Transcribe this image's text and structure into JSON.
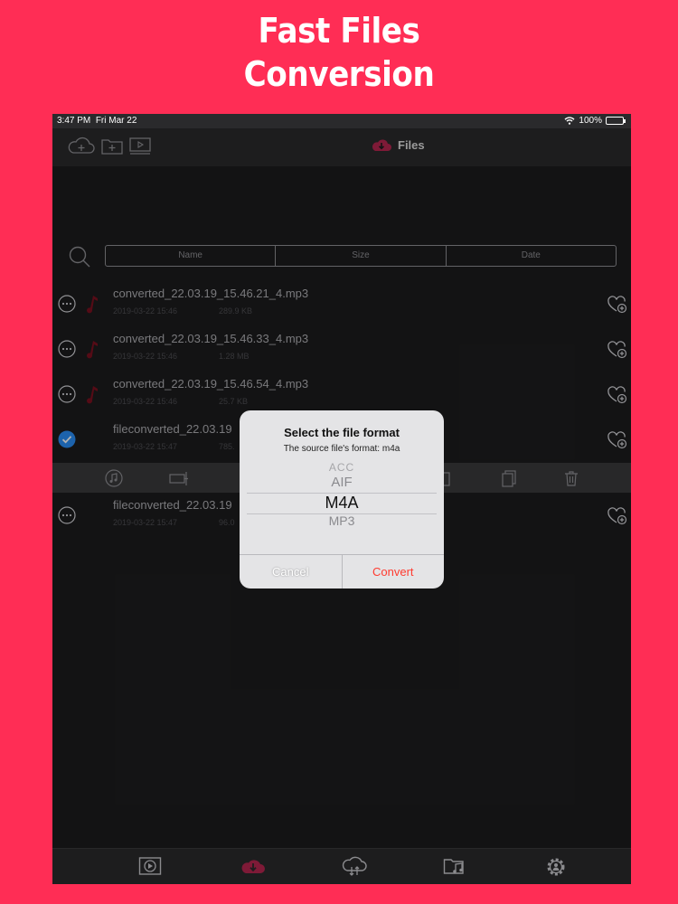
{
  "hero": {
    "line1": "Fast Files",
    "line2": "Conversion"
  },
  "status_bar": {
    "time": "3:47 PM",
    "date": "Fri Mar 22",
    "battery": "100%"
  },
  "nav": {
    "title": "Files",
    "icons": [
      "cloud-add-icon",
      "folder-add-icon",
      "media-icon",
      "cloud-download-icon"
    ]
  },
  "table_header": {
    "columns": [
      "Name",
      "Size",
      "Date"
    ]
  },
  "files": [
    {
      "name": "converted_22.03.19_15.46.21_4.mp3",
      "date": "2019-03-22 15:46",
      "size": "289.9 KB",
      "selected": false
    },
    {
      "name": "converted_22.03.19_15.46.33_4.mp3",
      "date": "2019-03-22 15:46",
      "size": "1.28 MB",
      "selected": false
    },
    {
      "name": "converted_22.03.19_15.46.54_4.mp3",
      "date": "2019-03-22 15:46",
      "size": "25.7 KB",
      "selected": false
    },
    {
      "name": "fileconverted_22.03.19",
      "date": "2019-03-22 15:47",
      "size": "785.",
      "selected": true
    },
    {
      "name": "fileconverted_22.03.19",
      "date": "2019-03-22 15:47",
      "size": "96.0",
      "selected": false
    }
  ],
  "toolbar": {
    "icons": [
      "music-note-icon",
      "convert-icon",
      "copy-icon",
      "duplicate-icon",
      "trash-icon"
    ]
  },
  "dialog": {
    "title": "Select the file format",
    "message": "The source file's format: m4a",
    "options": [
      "ACC",
      "AIF",
      "M4A",
      "MP3"
    ],
    "selected": "M4A",
    "cancel_label": "Cancel",
    "convert_label": "Convert"
  },
  "tabbar": {
    "icons": [
      "video-player-icon",
      "cloud-download-icon",
      "cloud-sync-icon",
      "music-folder-icon",
      "settings-icon"
    ],
    "active_index": 1
  },
  "colors": {
    "brand": "#ff2d55",
    "background": "#1c1c1e",
    "accent_blue": "#2a8ff7",
    "destructive": "#ff3b30",
    "note_red": "#7a1020"
  }
}
